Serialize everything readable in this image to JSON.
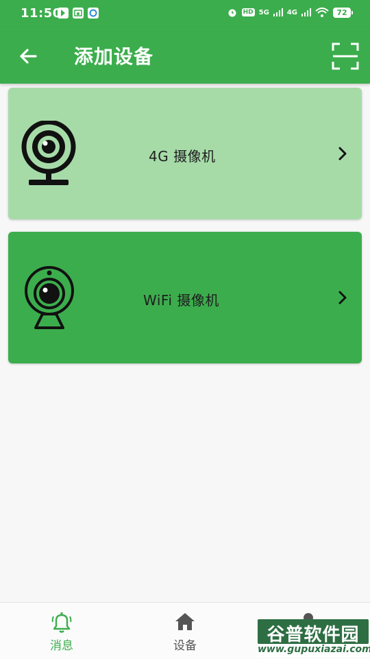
{
  "status_bar": {
    "time": "11:50",
    "network_1": "5G",
    "network_2": "4G",
    "hd": "HD",
    "battery": "72"
  },
  "app_bar": {
    "title": "添加设备"
  },
  "cards": [
    {
      "label": "4G 摄像机",
      "color": "#a6dba8"
    },
    {
      "label": "WiFi 摄像机",
      "color": "#3cad4d"
    }
  ],
  "bottom_nav": [
    {
      "label": "消息",
      "active": true
    },
    {
      "label": "设备",
      "active": false
    }
  ],
  "watermark": {
    "title": "谷普软件园",
    "url": "www.gupuxiazai.com"
  },
  "colors": {
    "primary": "#3cad4d",
    "card_light": "#a6dba8",
    "background": "#f7f7f7"
  }
}
